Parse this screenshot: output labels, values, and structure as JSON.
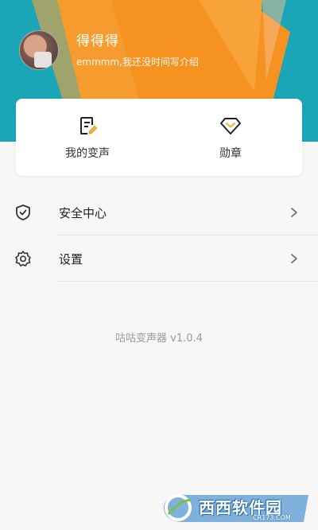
{
  "profile": {
    "username": "得得得",
    "bio": "emmmm,我还没时间写介绍"
  },
  "quick_actions": [
    {
      "label": "我的变声",
      "icon": "document-edit-icon"
    },
    {
      "label": "勋章",
      "icon": "medal-icon"
    }
  ],
  "menu": [
    {
      "label": "安全中心",
      "icon": "shield-check-icon"
    },
    {
      "label": "设置",
      "icon": "gear-icon"
    }
  ],
  "app_version": "咕咕变声器 v1.0.4",
  "watermark": {
    "main": "西西软件园",
    "sub": "CR173.COM"
  },
  "colors": {
    "header_orange": "#f59220",
    "header_teal": "#1aa6b7",
    "header_light_orange": "#f8a23a"
  }
}
